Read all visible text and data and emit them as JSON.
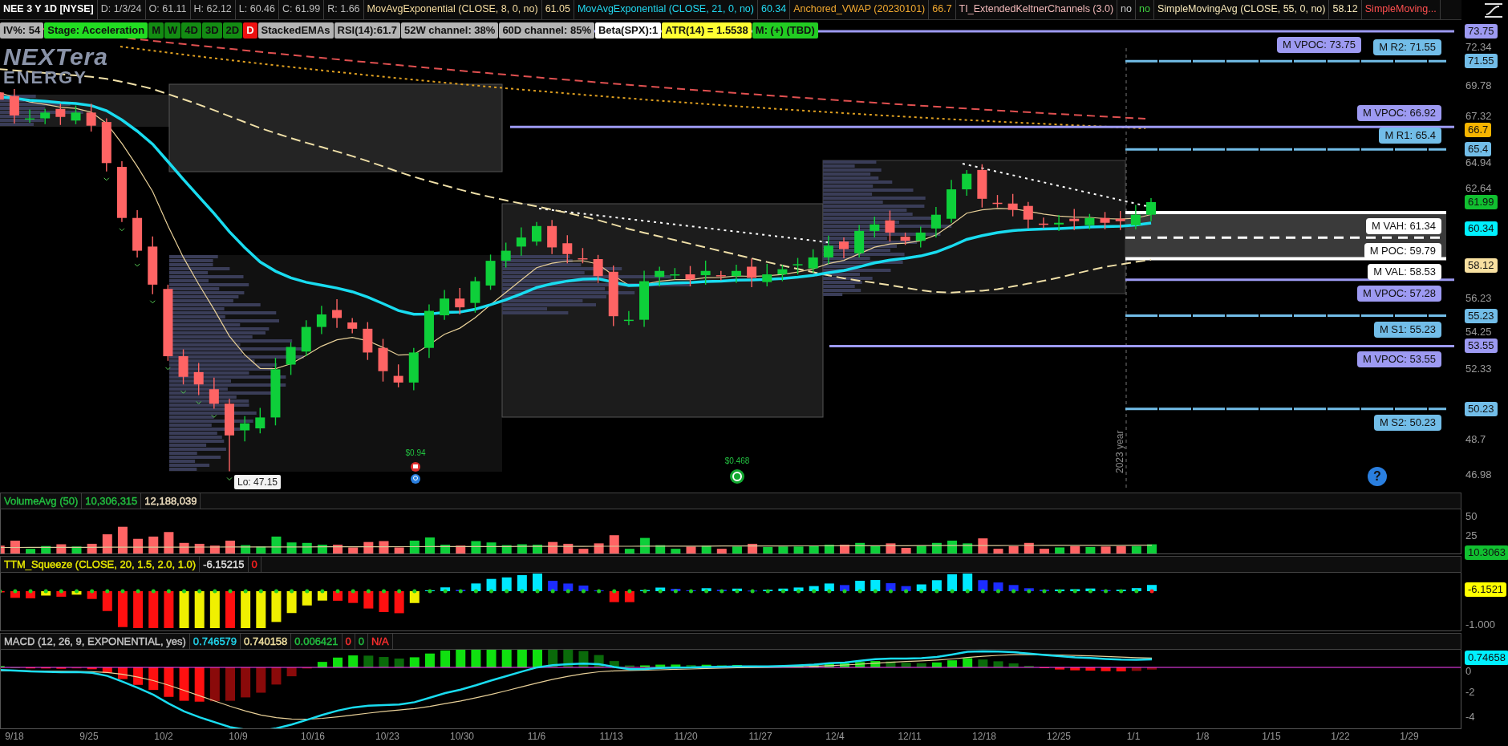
{
  "header": {
    "symbol": "NEE 3 Y 1D [NYSE]",
    "quote": [
      "D: 1/3/24",
      "O: 61.11",
      "H: 62.12",
      "L: 60.46",
      "C: 61.99",
      "R: 1.66"
    ],
    "studies": [
      {
        "text": "MovAvgExponential (CLOSE, 8, 0, no)",
        "color": "#f5dca0"
      },
      {
        "text": "61.05",
        "color": "#f5dca0"
      },
      {
        "text": "MovAvgExponential (CLOSE, 21, 0, no)",
        "color": "#22d8f0"
      },
      {
        "text": "60.34",
        "color": "#22d8f0"
      },
      {
        "text": "Anchored_VWAP (20230101)",
        "color": "#f0a830"
      },
      {
        "text": "66.7",
        "color": "#f0a830"
      },
      {
        "text": "TI_ExtendedKeltnerChannels (3.0)",
        "color": "#f0b8b8"
      },
      {
        "text": "no",
        "color": "#c8c8c8"
      },
      {
        "text": "no",
        "color": "#40d040"
      },
      {
        "text": "SimpleMovingAvg (CLOSE, 55, 0, no)",
        "color": "#f5e6b8"
      },
      {
        "text": "58.12",
        "color": "#f5e6b8"
      },
      {
        "text": "SimpleMoving...",
        "color": "#ff5050"
      }
    ]
  },
  "badges": [
    {
      "text": "IV%: 54",
      "color": "#b4b4b4"
    },
    {
      "text": "Stage: Acceleration",
      "color": "#22dd22"
    },
    {
      "text": "M",
      "color": "#138c13"
    },
    {
      "text": "W",
      "color": "#138c13"
    },
    {
      "text": "4D",
      "color": "#138c13"
    },
    {
      "text": "3D",
      "color": "#138c13"
    },
    {
      "text": "2D",
      "color": "#138c13"
    },
    {
      "text": "D",
      "color": "#ee1111"
    },
    {
      "text": "StackedEMAs",
      "color": "#b4b4b4"
    },
    {
      "text": "RSI(14):61.7",
      "color": "#b4b4b4"
    },
    {
      "text": "52W channel: 38%",
      "color": "#b4b4b4"
    },
    {
      "text": "60D channel: 85%",
      "color": "#b4b4b4"
    },
    {
      "text": "Beta(SPX):1",
      "color": "#ffffff"
    },
    {
      "text": "ATR(14) = 1.5538",
      "color": "#ffff33"
    },
    {
      "text": "M: (+) (TBD)",
      "color": "#22cc22"
    }
  ],
  "logo": {
    "text": "NEXTera",
    "subtext": "ENERGY"
  },
  "price_pane": {
    "axis_ticks": [
      "72.34",
      "69.78",
      "67.32",
      "64.94",
      "62.64",
      "56.23",
      "54.25",
      "52.33",
      "48.7",
      "46.98"
    ],
    "levels": [
      {
        "label": "M VPOC: 73.75",
        "kind": "vpoc",
        "color": "#9d9af2"
      },
      {
        "label": "M R2: 71.55",
        "kind": "pivot",
        "color": "#72bde8"
      },
      {
        "label": "M VPOC: 66.92",
        "kind": "vpoc",
        "color": "#9d9af2"
      },
      {
        "label": "M R1: 65.4",
        "kind": "pivot",
        "color": "#72bde8"
      },
      {
        "label": "M VAH: 61.34",
        "kind": "value_area",
        "color": "#ffffff"
      },
      {
        "label": "M POC: 59.79",
        "kind": "poc",
        "color": "#ffffff"
      },
      {
        "label": "M VAL: 58.53",
        "kind": "value_area",
        "color": "#ffffff"
      },
      {
        "label": "M VPOC: 57.28",
        "kind": "vpoc",
        "color": "#9d9af2"
      },
      {
        "label": "M S1: 55.23",
        "kind": "pivot",
        "color": "#72bde8"
      },
      {
        "label": "M VPOC: 53.55",
        "kind": "vpoc",
        "color": "#9d9af2"
      },
      {
        "label": "M S2: 50.23",
        "kind": "pivot",
        "color": "#72bde8"
      }
    ],
    "axis_tags": [
      {
        "text": "73.75",
        "color": "#9d9af2"
      },
      {
        "text": "71.55",
        "color": "#72bde8"
      },
      {
        "text": "66.7",
        "color": "#f5b400"
      },
      {
        "text": "65.4",
        "color": "#72bde8"
      },
      {
        "text": "61.99",
        "color": "#11c030"
      },
      {
        "text": "60.34",
        "color": "#00f0ff"
      },
      {
        "text": "58.12",
        "color": "#f8e0a0"
      },
      {
        "text": "55.23",
        "color": "#72bde8"
      },
      {
        "text": "53.55",
        "color": "#9d9af2"
      },
      {
        "text": "50.23",
        "color": "#72bde8"
      }
    ],
    "low_label": "Lo: 47.15",
    "dividends": [
      "$0.94",
      "$0.468"
    ],
    "year_marker": "2023 year",
    "help": "?"
  },
  "volume_pane": {
    "legend": [
      {
        "text": "VolumeAvg (50)",
        "color": "#22c040"
      },
      {
        "text": "10,306,315",
        "color": "#22c040"
      },
      {
        "text": "12,188,039",
        "color": "#f0e0c0"
      }
    ],
    "axis_ticks": [
      "50",
      "25"
    ],
    "tag": {
      "text": "10.3063",
      "color": "#11c030"
    }
  },
  "squeeze_pane": {
    "legend": [
      {
        "text": "TTM_Squeeze (CLOSE, 20, 1.5, 2.0, 1.0)",
        "color": "#e8e800"
      },
      {
        "text": "-6.15215",
        "color": "#e0e0e0"
      },
      {
        "text": "0",
        "color": "#ff2020"
      }
    ],
    "axis_ticks": [
      "-1.000"
    ],
    "tag": {
      "text": "-6.1521",
      "color": "#ffff00"
    }
  },
  "macd_pane": {
    "legend": [
      {
        "text": "MACD (12, 26, 9, EXPONENTIAL, yes)",
        "color": "#c8c8c8"
      },
      {
        "text": "0.746579",
        "color": "#22d8f0"
      },
      {
        "text": "0.740158",
        "color": "#f0e0a0"
      },
      {
        "text": "0.006421",
        "color": "#22c040"
      },
      {
        "text": "0",
        "color": "#ff3030"
      },
      {
        "text": "0",
        "color": "#22c040"
      },
      {
        "text": "N/A",
        "color": "#ff3030"
      }
    ],
    "axis_ticks": [
      "0",
      "-2",
      "-4"
    ],
    "tag": {
      "text": "0.74658",
      "color": "#00f0ff"
    }
  },
  "dates": [
    "9/18",
    "9/25",
    "10/2",
    "10/9",
    "10/16",
    "10/23",
    "10/30",
    "11/6",
    "11/13",
    "11/20",
    "11/27",
    "12/4",
    "12/11",
    "12/18",
    "12/25",
    "1/1",
    "1/8",
    "1/15",
    "1/22",
    "1/29"
  ]
}
